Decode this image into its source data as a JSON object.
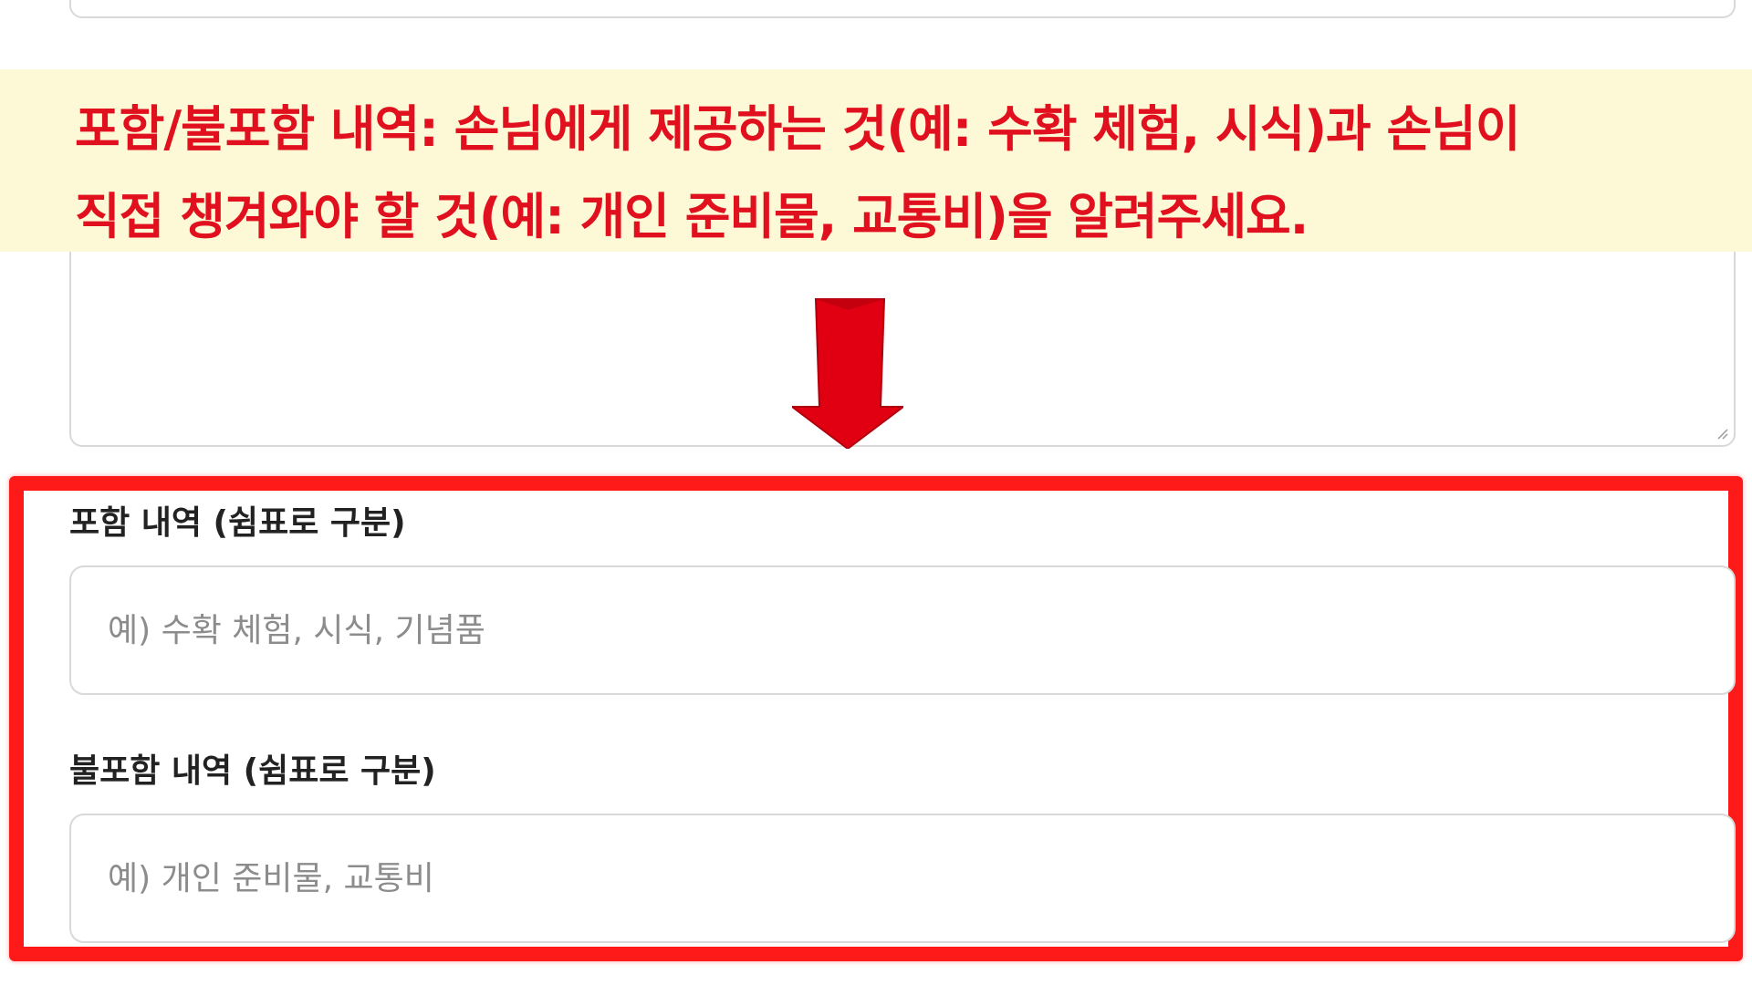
{
  "banner": {
    "line1": "포함/불포함 내역: 손님에게 제공하는 것(예: 수확 체험, 시식)과 손님이",
    "line2": "직접 챙겨와야 할 것(예: 개인 준비물, 교통비)을 알려주세요."
  },
  "form": {
    "included": {
      "label": "포함 내역 (쉼표로 구분)",
      "value": "",
      "placeholder": "예) 수확 체험, 시식, 기념품"
    },
    "excluded": {
      "label": "불포함 내역 (쉼표로 구분)",
      "value": "",
      "placeholder": "예) 개인 준비물, 교통비"
    }
  },
  "colors": {
    "annotation_red": "#e0101e",
    "banner_bg": "#fdf8d6",
    "highlight_border": "#ff1a1a",
    "input_border": "#d9d9d9"
  },
  "icons": {
    "arrow": "down-arrow-icon",
    "resize": "resize-handle-icon"
  }
}
